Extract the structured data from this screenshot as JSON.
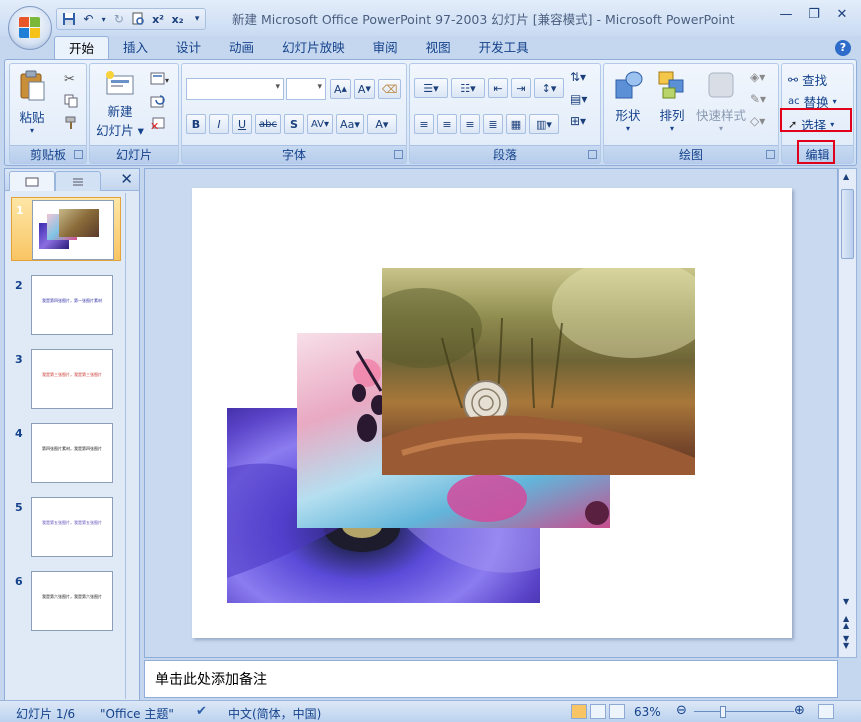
{
  "window": {
    "title": "新建 Microsoft Office PowerPoint 97-2003 幻灯片 [兼容模式] - Microsoft PowerPoint"
  },
  "qat": {
    "icons": [
      "save-icon",
      "undo-icon",
      "redo-icon",
      "print-preview-icon",
      "superscript-icon",
      "subscript-icon",
      "customize-icon"
    ],
    "superscript_label": "x²",
    "subscript_label": "x₂"
  },
  "tabs": [
    {
      "label": "开始",
      "active": true
    },
    {
      "label": "插入"
    },
    {
      "label": "设计"
    },
    {
      "label": "动画"
    },
    {
      "label": "幻灯片放映"
    },
    {
      "label": "审阅"
    },
    {
      "label": "视图"
    },
    {
      "label": "开发工具"
    }
  ],
  "ribbon": {
    "clipboard": {
      "label": "剪贴板",
      "paste": "粘贴"
    },
    "slides": {
      "label": "幻灯片",
      "new_slide_line1": "新建",
      "new_slide_line2": "幻灯片"
    },
    "font": {
      "label": "字体",
      "font_name": "",
      "font_size": ""
    },
    "paragraph": {
      "label": "段落"
    },
    "drawing": {
      "label": "绘图",
      "shapes": "形状",
      "arrange": "排列",
      "quick_styles": "快速样式"
    },
    "editing": {
      "label": "编辑",
      "find": "查找",
      "replace": "替换",
      "select": "选择"
    }
  },
  "colors": {
    "highlight_box": "#e0001a",
    "selected_thumb": "#f9c564"
  },
  "slides_pane": {
    "thumbs": [
      {
        "num": "1",
        "selected": true,
        "text": ""
      },
      {
        "num": "2",
        "text": "我是第四张图片，第一张图片素材",
        "color": "#2a2aa6"
      },
      {
        "num": "3",
        "text": "我是第三张图片，我是第三张图片",
        "color": "#c8322a"
      },
      {
        "num": "4",
        "text": "第四张图片素材，我是第四张图片",
        "color": "#111111"
      },
      {
        "num": "5",
        "text": "我是第五张图片，我是第五张图片",
        "color": "#5a4ab8"
      },
      {
        "num": "6",
        "text": "我是第六张图片，我是第六张图片",
        "color": "#111111"
      }
    ]
  },
  "notes": {
    "placeholder": "单击此处添加备注"
  },
  "status": {
    "slide": "幻灯片 1/6",
    "theme": "\"Office 主题\"",
    "language": "中文(简体，中国)",
    "zoom": "63%"
  }
}
